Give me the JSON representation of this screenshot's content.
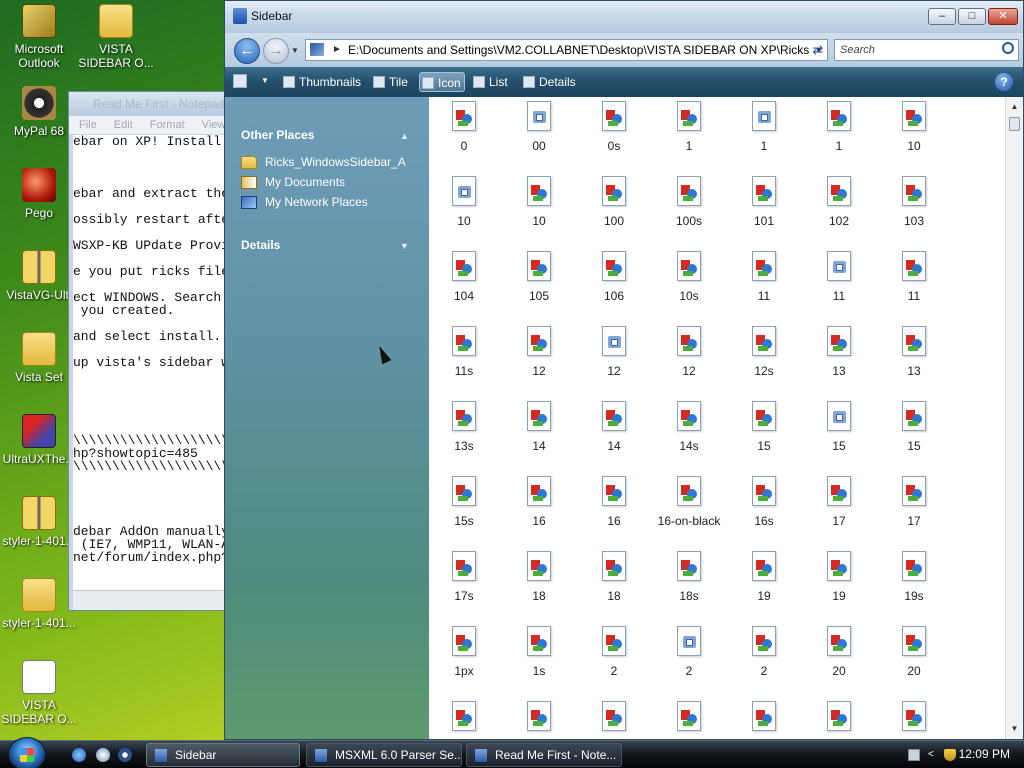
{
  "desktop": {
    "icons": [
      {
        "label": "Microsoft Outlook",
        "icon": "outlook-icon"
      },
      {
        "label": "VISTA SIDEBAR O...",
        "icon": "folder-icon"
      },
      {
        "label": "MyPal 68",
        "icon": "mypal-icon"
      },
      {
        "label": "Pego",
        "icon": "pego-icon"
      },
      {
        "label": "VistaVG-Ulti",
        "icon": "zip-icon"
      },
      {
        "label": "Vista Set",
        "icon": "folder-icon"
      },
      {
        "label": "UltraUXThe...",
        "icon": "ultraux-icon"
      },
      {
        "label": "styler-1-401...",
        "icon": "zip-icon"
      },
      {
        "label": "styler-1-401...",
        "icon": "folder-icon"
      },
      {
        "label": "VISTA SIDEBAR O...",
        "icon": "file-icon"
      }
    ]
  },
  "notepad": {
    "title": "Read Me First - Notepad",
    "menu": "File Edit Format View",
    "lines": [
      "ebar on XP! Install",
      "ebar and extract the",
      "ossibly restart afte",
      "WSXP-KB UPdate Provi",
      "e you put ricks file",
      "ect WINDOWS. Search",
      " you created.",
      "and select install.",
      "up vista's sidebar w",
      "\\\\\\\\\\\\\\\\\\\\\\\\\\\\\\\\\\\\\\\\",
      "hp?showtopic=485",
      "\\\\\\\\\\\\\\\\\\\\\\\\\\\\\\\\\\\\\\\\",
      "debar AddOn manually",
      " (IE7, WMP11, WLAN-A",
      "net/forum/index.php?"
    ]
  },
  "explorer": {
    "title": "Sidebar",
    "address": "E:\\Documents and Settings\\VM2.COLLABNET\\Desktop\\VISTA SIDEBAR ON XP\\Ricks",
    "search_placeholder": "Search",
    "toolbar": {
      "thumbnails": "Thumbnails",
      "tile": "Tile",
      "icon": "Icon",
      "list": "List",
      "details": "Details",
      "active_view": "Icon"
    },
    "left_pane": {
      "other_places_header": "Other Places",
      "other_places": [
        {
          "label": "Ricks_WindowsSidebar_A",
          "icon": "folder-icon"
        },
        {
          "label": "My Documents",
          "icon": "my-documents-icon"
        },
        {
          "label": "My Network Places",
          "icon": "network-places-icon"
        }
      ],
      "details_header": "Details"
    },
    "files": [
      {
        "name": "0",
        "kind": "image"
      },
      {
        "name": "00",
        "kind": "doc"
      },
      {
        "name": "0s",
        "kind": "image"
      },
      {
        "name": "1",
        "kind": "image"
      },
      {
        "name": "1",
        "kind": "doc"
      },
      {
        "name": "1",
        "kind": "image"
      },
      {
        "name": "10",
        "kind": "image"
      },
      {
        "name": "10",
        "kind": "doc"
      },
      {
        "name": "10",
        "kind": "image"
      },
      {
        "name": "100",
        "kind": "image"
      },
      {
        "name": "100s",
        "kind": "image"
      },
      {
        "name": "101",
        "kind": "image"
      },
      {
        "name": "102",
        "kind": "image"
      },
      {
        "name": "103",
        "kind": "image"
      },
      {
        "name": "104",
        "kind": "image"
      },
      {
        "name": "105",
        "kind": "image"
      },
      {
        "name": "106",
        "kind": "image"
      },
      {
        "name": "10s",
        "kind": "image"
      },
      {
        "name": "11",
        "kind": "image"
      },
      {
        "name": "11",
        "kind": "doc"
      },
      {
        "name": "11",
        "kind": "image"
      },
      {
        "name": "11s",
        "kind": "image"
      },
      {
        "name": "12",
        "kind": "image"
      },
      {
        "name": "12",
        "kind": "doc"
      },
      {
        "name": "12",
        "kind": "image"
      },
      {
        "name": "12s",
        "kind": "image"
      },
      {
        "name": "13",
        "kind": "image"
      },
      {
        "name": "13",
        "kind": "image"
      },
      {
        "name": "13s",
        "kind": "image"
      },
      {
        "name": "14",
        "kind": "image"
      },
      {
        "name": "14",
        "kind": "image"
      },
      {
        "name": "14s",
        "kind": "image"
      },
      {
        "name": "15",
        "kind": "image"
      },
      {
        "name": "15",
        "kind": "doc"
      },
      {
        "name": "15",
        "kind": "image"
      },
      {
        "name": "15s",
        "kind": "image"
      },
      {
        "name": "16",
        "kind": "image"
      },
      {
        "name": "16",
        "kind": "image"
      },
      {
        "name": "16-on-black",
        "kind": "image"
      },
      {
        "name": "16s",
        "kind": "image"
      },
      {
        "name": "17",
        "kind": "image"
      },
      {
        "name": "17",
        "kind": "image"
      },
      {
        "name": "17s",
        "kind": "image"
      },
      {
        "name": "18",
        "kind": "image"
      },
      {
        "name": "18",
        "kind": "image"
      },
      {
        "name": "18s",
        "kind": "image"
      },
      {
        "name": "19",
        "kind": "image"
      },
      {
        "name": "19",
        "kind": "image"
      },
      {
        "name": "19s",
        "kind": "image"
      },
      {
        "name": "1px",
        "kind": "image"
      },
      {
        "name": "1s",
        "kind": "image"
      },
      {
        "name": "2",
        "kind": "image"
      },
      {
        "name": "2",
        "kind": "doc"
      },
      {
        "name": "2",
        "kind": "image"
      },
      {
        "name": "20",
        "kind": "image"
      },
      {
        "name": "20",
        "kind": "image"
      },
      {
        "name": "",
        "kind": "image"
      },
      {
        "name": "",
        "kind": "image"
      },
      {
        "name": "",
        "kind": "image"
      },
      {
        "name": "",
        "kind": "image"
      },
      {
        "name": "",
        "kind": "image"
      },
      {
        "name": "",
        "kind": "image"
      },
      {
        "name": "",
        "kind": "image"
      }
    ]
  },
  "taskbar": {
    "tasks": [
      {
        "label": "Sidebar",
        "active": true
      },
      {
        "label": "MSXML 6.0 Parser Se...",
        "active": false
      },
      {
        "label": "Read Me First - Note...",
        "active": false
      }
    ],
    "clock": "12:09 PM"
  }
}
